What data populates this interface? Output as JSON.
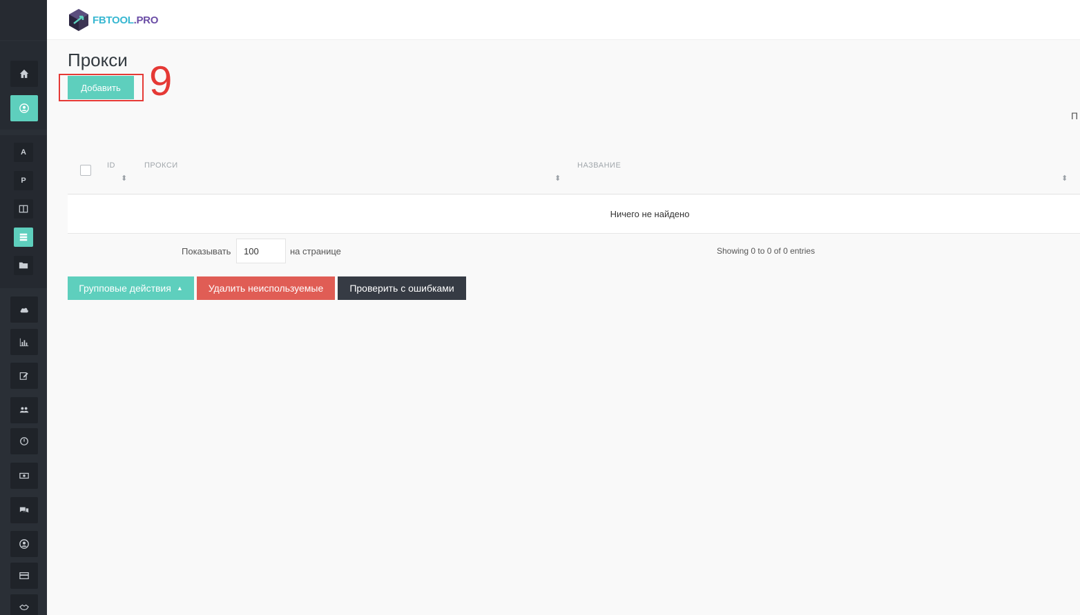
{
  "brand": {
    "name_part1": "FBTOOL",
    "name_part2": ".PRO"
  },
  "page": {
    "title": "Прокси",
    "add_label": "Добавить",
    "annotation": "9",
    "edge_char": "П"
  },
  "table": {
    "columns": [
      {
        "label": "ID"
      },
      {
        "label": "ПРОКСИ"
      },
      {
        "label": "НАЗВАНИЕ"
      }
    ],
    "empty_text": "Ничего не найдено"
  },
  "pager": {
    "per_page_label": "Показывать",
    "per_page_value": "100",
    "per_page_suffix": "на странице",
    "showing_text": "Showing 0 to 0 of 0 entries"
  },
  "actions": {
    "group_label": "Групповые действия",
    "delete_unused_label": "Удалить неиспользуемые",
    "check_errors_label": "Проверить с ошибками"
  },
  "sidebar": {
    "letter_items": [
      "A",
      "P"
    ]
  },
  "colors": {
    "accent": "#5ecfbd",
    "danger": "#e05d55",
    "dark": "#363b44",
    "sidebar": "#2a2f36",
    "annotation": "#e53935"
  }
}
